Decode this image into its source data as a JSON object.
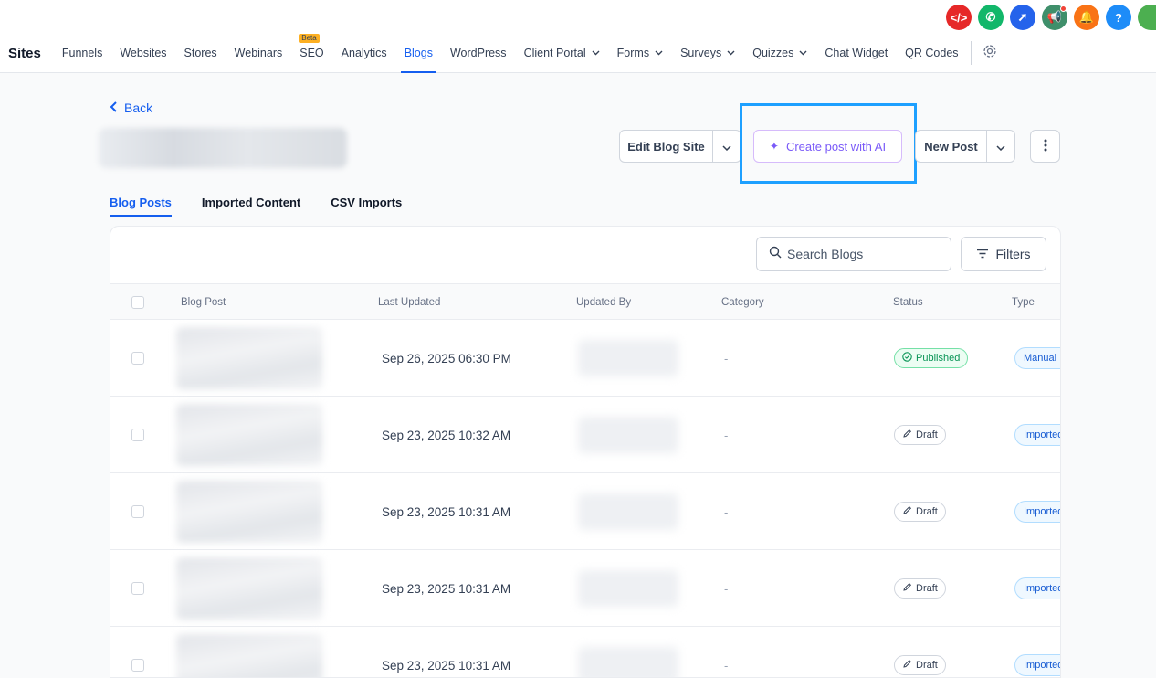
{
  "header": {
    "title": "Sites",
    "nav": [
      {
        "label": "Funnels",
        "name": "nav-funnels"
      },
      {
        "label": "Websites",
        "name": "nav-websites"
      },
      {
        "label": "Stores",
        "name": "nav-stores"
      },
      {
        "label": "Webinars",
        "name": "nav-webinars"
      },
      {
        "label": "SEO",
        "name": "nav-seo",
        "badge": "Beta"
      },
      {
        "label": "Analytics",
        "name": "nav-analytics"
      },
      {
        "label": "Blogs",
        "name": "nav-blogs",
        "active": true
      },
      {
        "label": "WordPress",
        "name": "nav-wordpress"
      },
      {
        "label": "Client Portal",
        "name": "nav-client-portal",
        "dropdown": true
      },
      {
        "label": "Forms",
        "name": "nav-forms",
        "dropdown": true
      },
      {
        "label": "Surveys",
        "name": "nav-surveys",
        "dropdown": true
      },
      {
        "label": "Quizzes",
        "name": "nav-quizzes",
        "dropdown": true
      },
      {
        "label": "Chat Widget",
        "name": "nav-chat-widget"
      },
      {
        "label": "QR Codes",
        "name": "nav-qr-codes"
      }
    ],
    "top_icons": [
      {
        "name": "code-icon",
        "color": "#e62828",
        "glyph": "</>"
      },
      {
        "name": "phone-icon",
        "color": "#12b76a",
        "glyph": "✆"
      },
      {
        "name": "rocket-icon",
        "color": "#2563eb",
        "glyph": "➚"
      },
      {
        "name": "megaphone-icon",
        "color": "#3f8f6b",
        "glyph": "📢",
        "dot": true
      },
      {
        "name": "bell-icon",
        "color": "#f97316",
        "glyph": "🔔"
      },
      {
        "name": "help-icon",
        "color": "#1d8cf8",
        "glyph": "?"
      },
      {
        "name": "profile-icon",
        "color": "#4caf50",
        "glyph": ""
      }
    ]
  },
  "page": {
    "back_label": "Back",
    "edit_blog_site": "Edit Blog Site",
    "create_post_ai": "Create post with AI",
    "new_post": "New Post"
  },
  "tabs": [
    {
      "label": "Blog Posts",
      "active": true
    },
    {
      "label": "Imported Content"
    },
    {
      "label": "CSV Imports"
    }
  ],
  "table": {
    "search_placeholder": "Search Blogs",
    "filters_label": "Filters",
    "columns": [
      "Blog Post",
      "Last Updated",
      "Updated By",
      "Category",
      "Status",
      "Type"
    ],
    "rows": [
      {
        "updated": "Sep 26, 2025 06:30 PM",
        "category": "-",
        "status": "Published",
        "status_type": "published",
        "type": "Manual"
      },
      {
        "updated": "Sep 23, 2025 10:32 AM",
        "category": "-",
        "status": "Draft",
        "status_type": "draft",
        "type": "Imported"
      },
      {
        "updated": "Sep 23, 2025 10:31 AM",
        "category": "-",
        "status": "Draft",
        "status_type": "draft",
        "type": "Imported"
      },
      {
        "updated": "Sep 23, 2025 10:31 AM",
        "category": "-",
        "status": "Draft",
        "status_type": "draft",
        "type": "Imported"
      },
      {
        "updated": "Sep 23, 2025 10:31 AM",
        "category": "-",
        "status": "Draft",
        "status_type": "draft",
        "type": "Imported"
      }
    ]
  }
}
